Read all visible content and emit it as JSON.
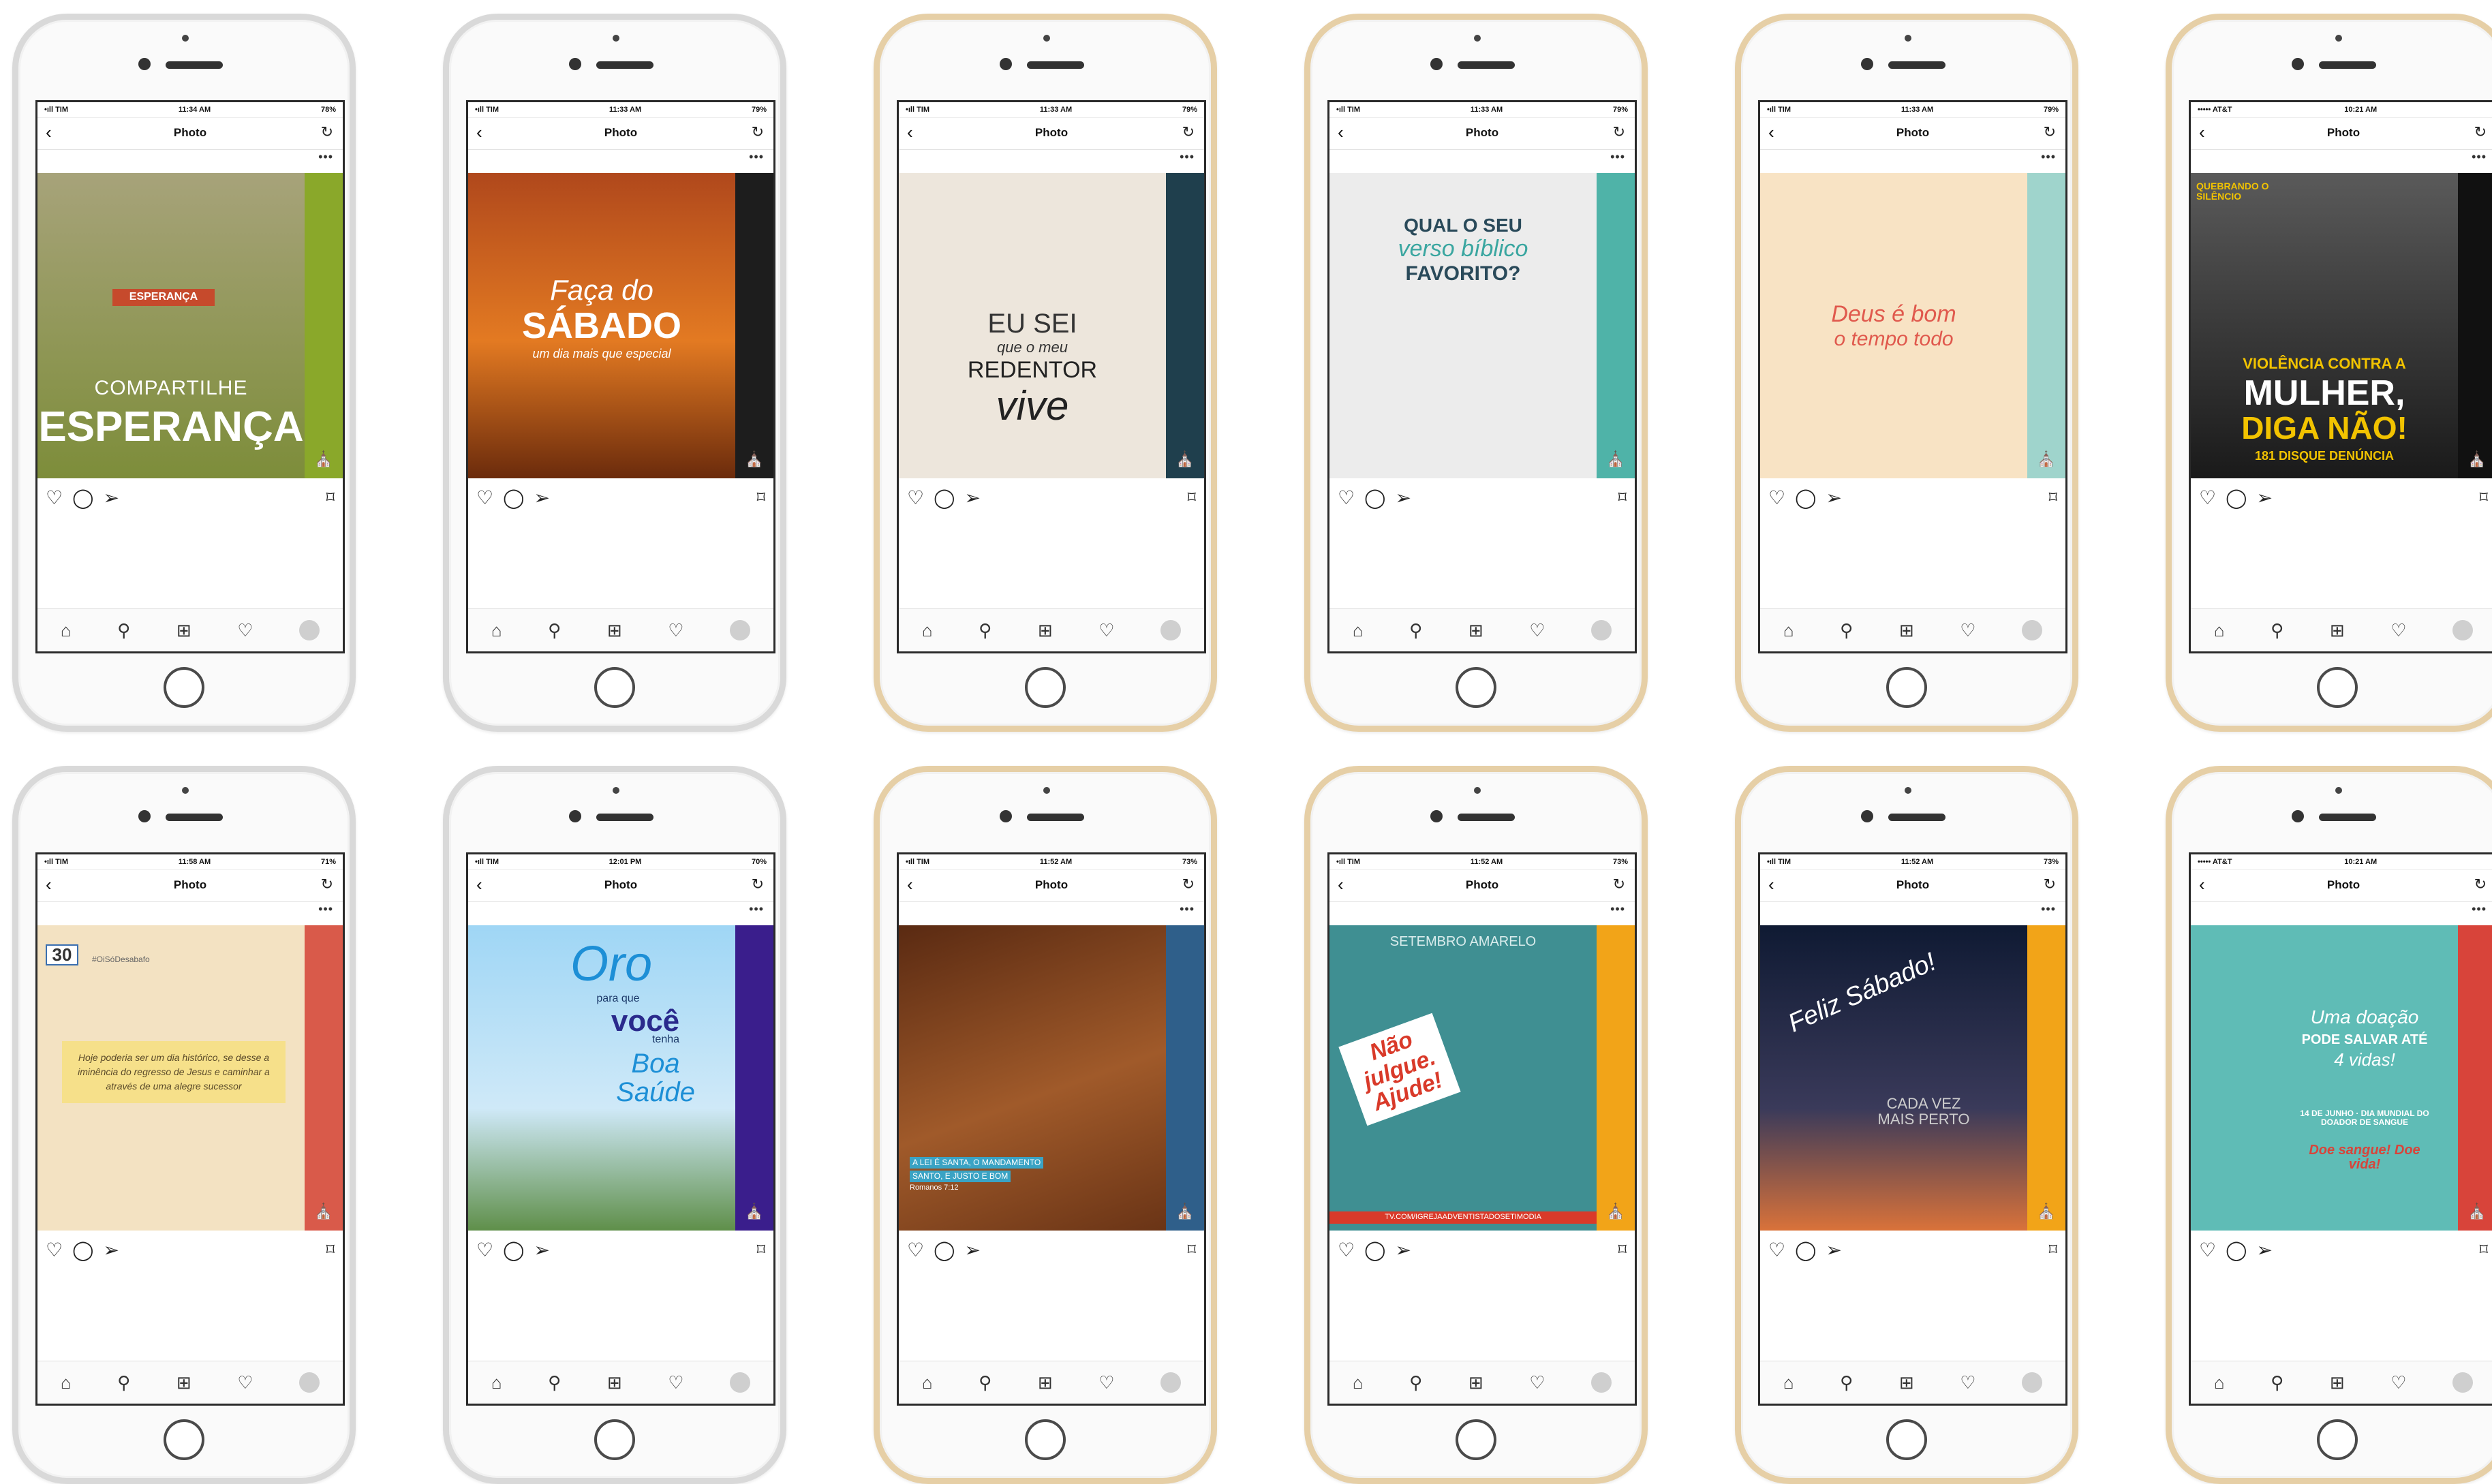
{
  "common": {
    "nav_title": "Photo",
    "back_icon": "chevron-left-icon",
    "reload_icon": "reload-icon",
    "more_label": "•••",
    "action_icons": [
      "heart-icon",
      "comment-icon",
      "send-icon",
      "bookmark-icon"
    ],
    "tab_icons": [
      "home-icon",
      "search-icon",
      "add-post-icon",
      "activity-heart-icon",
      "profile-avatar"
    ]
  },
  "phones": [
    {
      "carrier": "•ıll TIM",
      "time": "11:34 AM",
      "battery": "78%",
      "post": {
        "line1": "COMPARTILHE",
        "line2": "ESPERANÇA",
        "badge": "ESPERANÇA",
        "art_color": "#8a9a3c",
        "strip_color": "#8aa82a"
      }
    },
    {
      "carrier": "•ıll TIM",
      "time": "11:33 AM",
      "battery": "79%",
      "post": {
        "line1": "Faça do",
        "line2": "SÁBADO",
        "line3": "um dia mais que especial",
        "art_color": "#d9611c",
        "strip_color": "#1d1d1d"
      }
    },
    {
      "carrier": "•ıll TIM",
      "time": "11:33 AM",
      "battery": "79%",
      "post": {
        "line1": "EU SEI",
        "line2": "que o meu",
        "line3": "REDENTOR",
        "line4": "vive",
        "art_color": "#ede6dc",
        "strip_color": "#1f3f4d"
      }
    },
    {
      "carrier": "•ıll TIM",
      "time": "11:33 AM",
      "battery": "79%",
      "post": {
        "line1": "QUAL O SEU",
        "line2": "verso bíblico",
        "line3": "FAVORITO?",
        "art_color": "#ececec",
        "strip_color": "#4fb3a8"
      }
    },
    {
      "carrier": "•ıll TIM",
      "time": "11:33 AM",
      "battery": "79%",
      "post": {
        "line1": "Deus é bom",
        "line2": "o tempo todo",
        "art_color": "#f8e3c4",
        "strip_color": "#9fd4cc"
      }
    },
    {
      "carrier": "••••• AT&T",
      "time": "10:21 AM",
      "battery": "",
      "post": {
        "line0": "QUEBRANDO O SILÊNCIO",
        "line1": "VIOLÊNCIA CONTRA A",
        "line2": "MULHER,",
        "line3": "DIGA NÃO!",
        "line4": "181 DISQUE DENÚNCIA",
        "art_color": "#2a2a2a",
        "strip_color": "#111111"
      }
    },
    {
      "carrier": "•ıll TIM",
      "time": "11:58 AM",
      "battery": "71%",
      "post": {
        "date": "30",
        "tag": "#OiSóDesabafo",
        "note": "Hoje poderia ser um dia histórico, se desse a iminência do regresso de Jesus e caminhar a através de uma alegre sucessor",
        "art_color": "#f3e2c2",
        "strip_color": "#d95a4a"
      }
    },
    {
      "carrier": "•ıll TIM",
      "time": "12:01 PM",
      "battery": "70%",
      "post": {
        "line1": "Oro",
        "line2": "para que",
        "line3": "você",
        "line4": "tenha",
        "line5": "Boa Saúde",
        "art_color": "#87c4e8",
        "strip_color": "#3a1e8c"
      }
    },
    {
      "carrier": "•ıll TIM",
      "time": "11:52 AM",
      "battery": "73%",
      "post": {
        "line1": "A LEI É SANTA, O MANDAMENTO",
        "line2": "SANTO, E JUSTO E BOM",
        "line3": "Romanos 7:12",
        "art_color": "#8a4a24",
        "strip_color": "#2f5f8a"
      }
    },
    {
      "carrier": "•ıll TIM",
      "time": "11:52 AM",
      "battery": "73%",
      "post": {
        "line1": "SETEMBRO AMARELO",
        "line2": "Não julgue. Ajude!",
        "line3": "TV.COM/IGREJAADVENTISTADOSETIMODIA",
        "art_color": "#3f8f92",
        "strip_color": "#f2a418"
      }
    },
    {
      "carrier": "•ıll TIM",
      "time": "11:52 AM",
      "battery": "73%",
      "post": {
        "line1": "Feliz Sábado!",
        "line2": "CADA VEZ MAIS PERTO",
        "art_color": "#1b2a44",
        "strip_color": "#f2a418"
      }
    },
    {
      "carrier": "••••• AT&T",
      "time": "10:21 AM",
      "battery": "",
      "post": {
        "line1": "Uma doação",
        "line2": "PODE SALVAR ATÉ",
        "line3": "4 vidas!",
        "line4": "14 DE JUNHO · DIA MUNDIAL DO DOADOR DE SANGUE",
        "line5": "Doe sangue! Doe vida!",
        "art_color": "#5fbcb6",
        "strip_color": "#d8443a"
      }
    }
  ]
}
